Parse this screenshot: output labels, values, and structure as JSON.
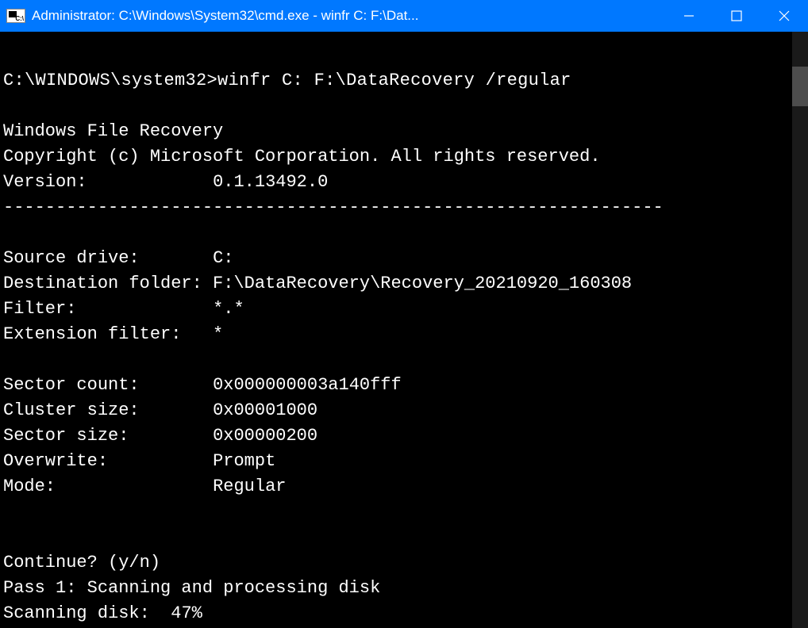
{
  "titlebar": {
    "title": "Administrator: C:\\Windows\\System32\\cmd.exe - winfr  C: F:\\Dat..."
  },
  "console": {
    "prompt": "C:\\WINDOWS\\system32>",
    "command": "winfr C: F:\\DataRecovery /regular",
    "appName": "Windows File Recovery",
    "copyright": "Copyright (c) Microsoft Corporation. All rights reserved.",
    "versionLabel": "Version:",
    "versionValue": "0.1.13492.0",
    "divider": "---------------------------------------------------------------",
    "fields": {
      "sourceDriveLabel": "Source drive:",
      "sourceDriveValue": "C:",
      "destFolderLabel": "Destination folder:",
      "destFolderValue": "F:\\DataRecovery\\Recovery_20210920_160308",
      "filterLabel": "Filter:",
      "filterValue": "*.*",
      "extFilterLabel": "Extension filter:",
      "extFilterValue": "*",
      "sectorCountLabel": "Sector count:",
      "sectorCountValue": "0x000000003a140fff",
      "clusterSizeLabel": "Cluster size:",
      "clusterSizeValue": "0x00001000",
      "sectorSizeLabel": "Sector size:",
      "sectorSizeValue": "0x00000200",
      "overwriteLabel": "Overwrite:",
      "overwriteValue": "Prompt",
      "modeLabel": "Mode:",
      "modeValue": "Regular"
    },
    "continuePrompt": "Continue? (y/n)",
    "passLine": "Pass 1: Scanning and processing disk",
    "scanLabel": "Scanning disk:",
    "scanPercent": "47%"
  }
}
